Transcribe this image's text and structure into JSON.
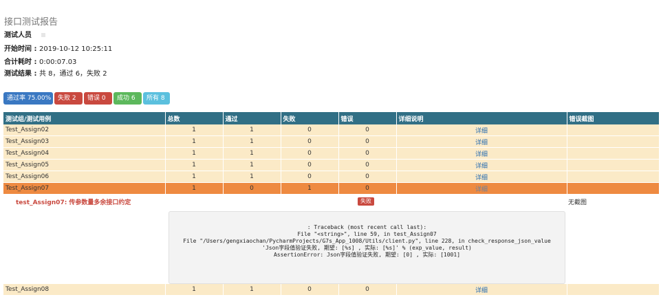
{
  "report": {
    "title": "接口测试报告",
    "tester_label": "测试人员",
    "start_time_label": "开始时间 : ",
    "start_time": "2019-10-12 10:25:11",
    "duration_label": "合计耗时 : ",
    "duration": "0:00:07.03",
    "result_label": "测试结果 : ",
    "result": "共 8，通过 6，失败 2"
  },
  "filters": {
    "pass_rate": "通过率 75.00%",
    "fail": "失败 2",
    "error": "错误 0",
    "success": "成功 6",
    "all": "所有 8"
  },
  "colors": {
    "header_bg": "#316f85",
    "row_bg": "#fbeac7",
    "fail_row_bg": "#ee8a41",
    "danger": "#c9493f",
    "success": "#5cb85c",
    "info": "#5bc0de",
    "primary": "#3a78c2"
  },
  "table": {
    "headers": [
      "测试组/测试用例",
      "总数",
      "通过",
      "失败",
      "错误",
      "详细说明",
      "错误截图"
    ],
    "rows": [
      {
        "name": "Test_Assign02",
        "total": "1",
        "pass": "1",
        "fail": "0",
        "error": "0",
        "detail": "详细",
        "shot": ""
      },
      {
        "name": "Test_Assign03",
        "total": "1",
        "pass": "1",
        "fail": "0",
        "error": "0",
        "detail": "详细",
        "shot": ""
      },
      {
        "name": "Test_Assign04",
        "total": "1",
        "pass": "1",
        "fail": "0",
        "error": "0",
        "detail": "详细",
        "shot": ""
      },
      {
        "name": "Test_Assign05",
        "total": "1",
        "pass": "1",
        "fail": "0",
        "error": "0",
        "detail": "详细",
        "shot": ""
      },
      {
        "name": "Test_Assign06",
        "total": "1",
        "pass": "1",
        "fail": "0",
        "error": "0",
        "detail": "详细",
        "shot": ""
      },
      {
        "name": "Test_Assign07",
        "total": "1",
        "pass": "0",
        "fail": "1",
        "error": "0",
        "detail": "详细",
        "shot": ""
      },
      {
        "name": "Test_Assign08",
        "total": "1",
        "pass": "1",
        "fail": "0",
        "error": "0",
        "detail": "详细",
        "shot": ""
      }
    ],
    "failed_detail": {
      "case_name": "test_Assign07: 传参数量多余接口约定",
      "status_badge": "失败",
      "no_screenshot": "无截图",
      "traceback": [
        ": Traceback (most recent call last):",
        "File \"<string>\", line 59, in test_Assign07",
        "File \"/Users/gengxiaochan/PycharmProjects/G7s_App_1008/Utils/client.py\", line 228, in check_response_json_value",
        "'Json字段值验证失败, 期望: [%s] , 实际: [%s]' % (exp_value, result)",
        "AssertionError: Json字段值验证失败, 期望: [0] , 实际: [1001]"
      ]
    }
  }
}
